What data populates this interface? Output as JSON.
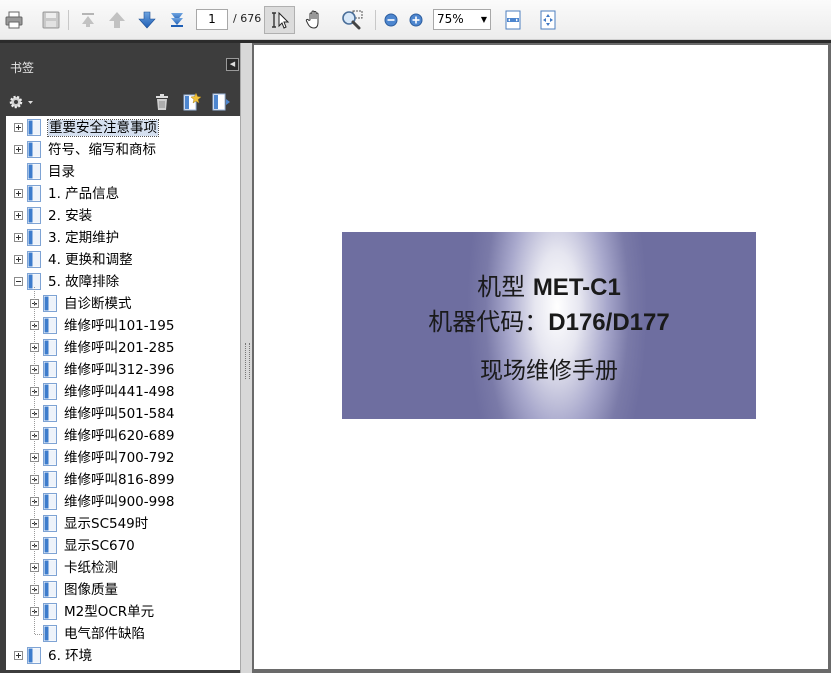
{
  "toolbar": {
    "page_current": "1",
    "page_total": "/ 676",
    "zoom": "75%",
    "icons": [
      "print-icon",
      "save-icon",
      "first-page-icon",
      "previous-page-icon",
      "next-page-icon",
      "last-page-icon",
      "select-tool-icon",
      "hand-tool-icon",
      "marquee-zoom-icon",
      "zoom-out-icon",
      "zoom-in-icon",
      "fit-width-icon",
      "fit-page-icon"
    ]
  },
  "bookmarks_panel": {
    "title": "书签",
    "items": [
      {
        "label": "重要安全注意事项",
        "level": 0,
        "expandable": true,
        "expanded": false,
        "selected": true
      },
      {
        "label": "符号、缩写和商标",
        "level": 0,
        "expandable": true,
        "expanded": false
      },
      {
        "label": "目录",
        "level": 0,
        "expandable": false
      },
      {
        "label": "1. 产品信息",
        "level": 0,
        "expandable": true,
        "expanded": false
      },
      {
        "label": "2. 安装",
        "level": 0,
        "expandable": true,
        "expanded": false
      },
      {
        "label": "3. 定期维护",
        "level": 0,
        "expandable": true,
        "expanded": false
      },
      {
        "label": "4. 更换和调整",
        "level": 0,
        "expandable": true,
        "expanded": false
      },
      {
        "label": "5. 故障排除",
        "level": 0,
        "expandable": true,
        "expanded": true
      },
      {
        "label": "自诊断模式",
        "level": 1,
        "expandable": true,
        "expanded": false
      },
      {
        "label": "维修呼叫101-195",
        "level": 1,
        "expandable": true,
        "expanded": false
      },
      {
        "label": "维修呼叫201-285",
        "level": 1,
        "expandable": true,
        "expanded": false
      },
      {
        "label": "维修呼叫312-396",
        "level": 1,
        "expandable": true,
        "expanded": false
      },
      {
        "label": "维修呼叫441-498",
        "level": 1,
        "expandable": true,
        "expanded": false
      },
      {
        "label": "维修呼叫501-584",
        "level": 1,
        "expandable": true,
        "expanded": false
      },
      {
        "label": "维修呼叫620-689",
        "level": 1,
        "expandable": true,
        "expanded": false
      },
      {
        "label": "维修呼叫700-792",
        "level": 1,
        "expandable": true,
        "expanded": false
      },
      {
        "label": "维修呼叫816-899",
        "level": 1,
        "expandable": true,
        "expanded": false
      },
      {
        "label": "维修呼叫900-998",
        "level": 1,
        "expandable": true,
        "expanded": false
      },
      {
        "label": "显示SC549时",
        "level": 1,
        "expandable": true,
        "expanded": false
      },
      {
        "label": "显示SC670",
        "level": 1,
        "expandable": true,
        "expanded": false
      },
      {
        "label": "卡纸检测",
        "level": 1,
        "expandable": true,
        "expanded": false
      },
      {
        "label": "图像质量",
        "level": 1,
        "expandable": true,
        "expanded": false
      },
      {
        "label": "M2型OCR单元",
        "level": 1,
        "expandable": true,
        "expanded": false
      },
      {
        "label": "电气部件缺陷",
        "level": 1,
        "expandable": false
      },
      {
        "label": "6. 环境",
        "level": 0,
        "expandable": true,
        "expanded": false
      }
    ]
  },
  "document": {
    "line1_cn": "机型 ",
    "line1_model": "MET-C1",
    "line2_cn": "机器代码：",
    "line2_code": "D176/D177",
    "line3": "现场维修手册"
  }
}
